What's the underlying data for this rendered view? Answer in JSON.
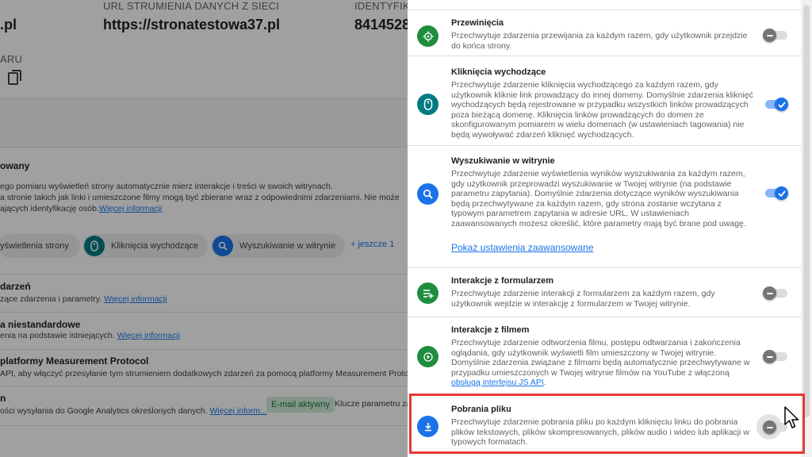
{
  "background": {
    "url_label": "URL STRUMIENIA DANYCH Z SIECI",
    "url_value": "https://stronatestowa37.pl",
    "id_label": "IDENTYFIKA",
    "id_value": "8414528",
    "left_value": ".pl",
    "left_label": "ARU",
    "section_title": "owany",
    "section_line1": "ego pomiaru wyświetleń strony automatycznie mierz interakcje i treści w swoich witrynach.",
    "section_line2": "a stronie takich jak linki i umieszczone filmy mogą być zbierane wraz z odpowiednimi zdarzeniami. Nie może",
    "section_line3": "ających identyfikację osób.",
    "more_info": "Więcej informacji",
    "chips": [
      {
        "label": "yświetlenia strony"
      },
      {
        "label": "Kliknięcia wychodzące"
      },
      {
        "label": "Wyszukiwanie w witrynie"
      }
    ],
    "more_chips": "+ jeszcze 1",
    "rows": [
      {
        "title": "darzeń",
        "desc": "zące zdarzenia i parametry.",
        "link": "Więcej informacji"
      },
      {
        "title": "a niestandardowe",
        "desc": "enia na podstawie istniejących.",
        "link": "Więcej informacji"
      },
      {
        "title": "platformy Measurement Protocol",
        "desc": "API, aby włączyć przesyłanie tym strumieniem dodatkowych zdarzeń za pomocą platformy Measurement Proto",
        "link": ""
      },
      {
        "title": "n",
        "desc": "ości wysyłania do Google Analytics określonych danych.",
        "link": "Więcej inform..."
      }
    ],
    "email_badge": "E-mail aktywny",
    "keys_text": "Klucze parametru za"
  },
  "drawer": {
    "items": [
      {
        "title": "Przewinięcia",
        "desc": "Przechwytuje zdarzenia przewijania za każdym razem, gdy użytkownik przejdzie do końca strony.",
        "icon": "crosshair-icon",
        "enabled": false
      },
      {
        "title": "Kliknięcia wychodzące",
        "desc": "Przechwytuje zdarzenie kliknięcia wychodzącego za każdym razem, gdy użytkownik kliknie link prowadzący do innej domeny. Domyślnie zdarzenia kliknięć wychodzących będą rejestrowane w przypadku wszystkich linków prowadzących poza bieżącą domenę. Kliknięcia linków prowadzących do domen ze skonfigurowanym pomiarem w wielu domenach (w ustawieniach tagowania) nie będą wywoływać zdarzeń kliknięć wychodzących.",
        "icon": "mouse-icon",
        "enabled": true
      },
      {
        "title": "Wyszukiwanie w witrynie",
        "desc": "Przechwytuje zdarzenie wyświetlenia wyników wyszukiwania za każdym razem, gdy użytkownik przeprowadzi wyszukiwanie w Twojej witrynie (na podstawie parametru zapytania). Domyślnie zdarzenia dotyczące wyników wyszukiwania będą przechwytywane za każdym razem, gdy strona zostanie wczytana z typowym parametrem zapytania w adresie URL. W ustawieniach zaawansowanych możesz określić, które parametry mają być brane pod uwagę.",
        "icon": "search-icon",
        "enabled": true
      },
      {
        "title": "Interakcje z formularzem",
        "desc": "Przechwytuje zdarzenie interakcji z formularzem za każdym razem, gdy użytkownik wejdzie w interakcję z formularzem w Twojej witrynie.",
        "icon": "form-icon",
        "enabled": false
      },
      {
        "title": "Interakcje z filmem",
        "desc": "Przechwytuje zdarzenie odtworzenia filmu, postępu odtwarzania i zakończenia oglądania, gdy użytkownik wyświetli film umieszczony w Twojej witrynie. Domyślnie zdarzenia związane z filmami będą automatycznie przechwytywane w przypadku umieszczonych w Twojej witrynie filmów na YouTube z włączoną",
        "desc_link": "obsługą interfejsu JS API",
        "desc_end": ".",
        "icon": "play-icon",
        "enabled": false
      },
      {
        "title": "Pobrania pliku",
        "desc": "Przechwytuje zdarzenie pobrania pliku po każdym kliknięciu linku do pobrania plików tekstowych, plików skompresowanych, plików audio i wideo lub aplikacji w typowych formatach.",
        "icon": "download-icon",
        "enabled": false
      }
    ],
    "advanced_link": "Pokaż ustawienia zaawansowane"
  },
  "colors": {
    "green": "#1e8e3e",
    "teal": "#007b83",
    "blue": "#1a73e8",
    "highlight": "#e53935"
  }
}
